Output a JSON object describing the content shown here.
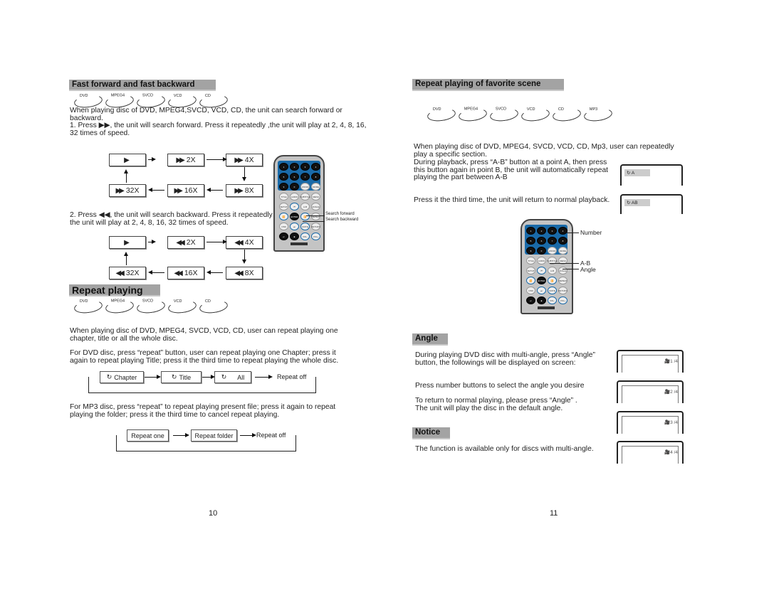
{
  "left": {
    "ff": {
      "title": "Fast forward and fast backward",
      "discs": [
        "DVD",
        "MPEG4",
        "SVCD",
        "VCD",
        "CD"
      ],
      "lines": [
        "When playing disc of DVD, MPEG4,SVCD, VCD, CD, the unit can search forward or",
        "backward.",
        "1. Press ▶▶, the unit will search forward. Press it repeatedly ,the unit will play at 2, 4, 8, 16,",
        "   32 times of speed."
      ],
      "fwd": [
        "",
        "2X",
        "4X",
        "32X",
        "16X",
        "8X"
      ],
      "back_lines": [
        "2. Press ◀◀, the unit will search backward. Press it repeatedly ,",
        "    the unit will play at 2, 4, 8, 16, 32 times of speed."
      ],
      "bwd": [
        "",
        "2X",
        "4X",
        "32X",
        "16X",
        "8X"
      ],
      "remote_labels": [
        "Search forward",
        "Search backward"
      ]
    },
    "repeat": {
      "title": "Repeat playing",
      "discs": [
        "DVD",
        "MPEG4",
        "SVCD",
        "VCD",
        "CD"
      ],
      "lines": [
        "When playing disc of DVD, MPEG4, SVCD, VCD, CD,  user can repeat playing one",
        " chapter, title or all the whole disc.",
        "For DVD disc, press “repeat” button, user can repeat playing one Chapter; press it",
        "again to repeat playing Title; press it the third time to repeat playing the whole disc."
      ],
      "dvd_chain": [
        "Chapter",
        "Title",
        "All",
        "Repeat off"
      ],
      "mp3_lines": [
        "For MP3 disc, press “repeat” to repeat playing present file; press it again to repeat",
        "playing the folder; press it the third time to cancel repeat playing."
      ],
      "mp3_chain": [
        "Repeat one",
        "Repeat folder",
        "Repeat off"
      ]
    },
    "page_number": "10"
  },
  "right": {
    "ab": {
      "title": "Repeat playing of favorite scene",
      "discs": [
        "DVD",
        "MPEG4",
        "SVCD",
        "VCD",
        "CD",
        "MP3"
      ],
      "lines": [
        "When playing disc of DVD, MPEG4, SVCD, VCD, CD, Mp3,  user can repeatedly",
        "play a specific section.",
        "During playback, press “A-B” button at a point A, then press",
        "this button again in  point B, the unit will automatically repeat",
        "playing the part between A-B"
      ],
      "third": "Press it the third time, the unit will return to normal playback.",
      "osd": [
        "A",
        "AB"
      ],
      "remote_labels": [
        "Number",
        "A-B",
        "Angle"
      ]
    },
    "angle": {
      "title": "Angle",
      "lines": [
        "During playing DVD disc with multi-angle, press “Angle”",
        " button, the followings will be displayed on screen:",
        "Press number buttons to select the angle you desire",
        "To return to normal playing, please press “Angle” .",
        "The unit will play the disc in the default angle."
      ],
      "screens": [
        "1 /4",
        "2 /4",
        "3 /4",
        "4 /4"
      ]
    },
    "notice": {
      "title": "Notice",
      "text": "The function is available only for discs with multi-angle."
    },
    "page_number": "11"
  },
  "remote_keys": [
    [
      "1",
      "2",
      "3",
      "4"
    ],
    [
      "5",
      "6",
      "7",
      "8"
    ],
    [
      "9",
      "0",
      "ZOOM",
      "MODE"
    ],
    [
      "TITLE",
      "AUDIO",
      "SUBTITLE",
      "MENU"
    ],
    [
      "SETUP",
      "⏮",
      "A-B",
      "ANGLE"
    ],
    [
      "⏪",
      "ENTER",
      "⏩",
      "REPEAT"
    ],
    [
      "OSD",
      "⏭",
      "MUTE",
      "RETURN"
    ],
    [
      "⏯",
      "■",
      "VOL-",
      "VOL+"
    ]
  ],
  "colors": {
    "header": "#a3a3a3",
    "remote_blue": "#1a6aa8",
    "remote_body": "#c4c4c4"
  }
}
